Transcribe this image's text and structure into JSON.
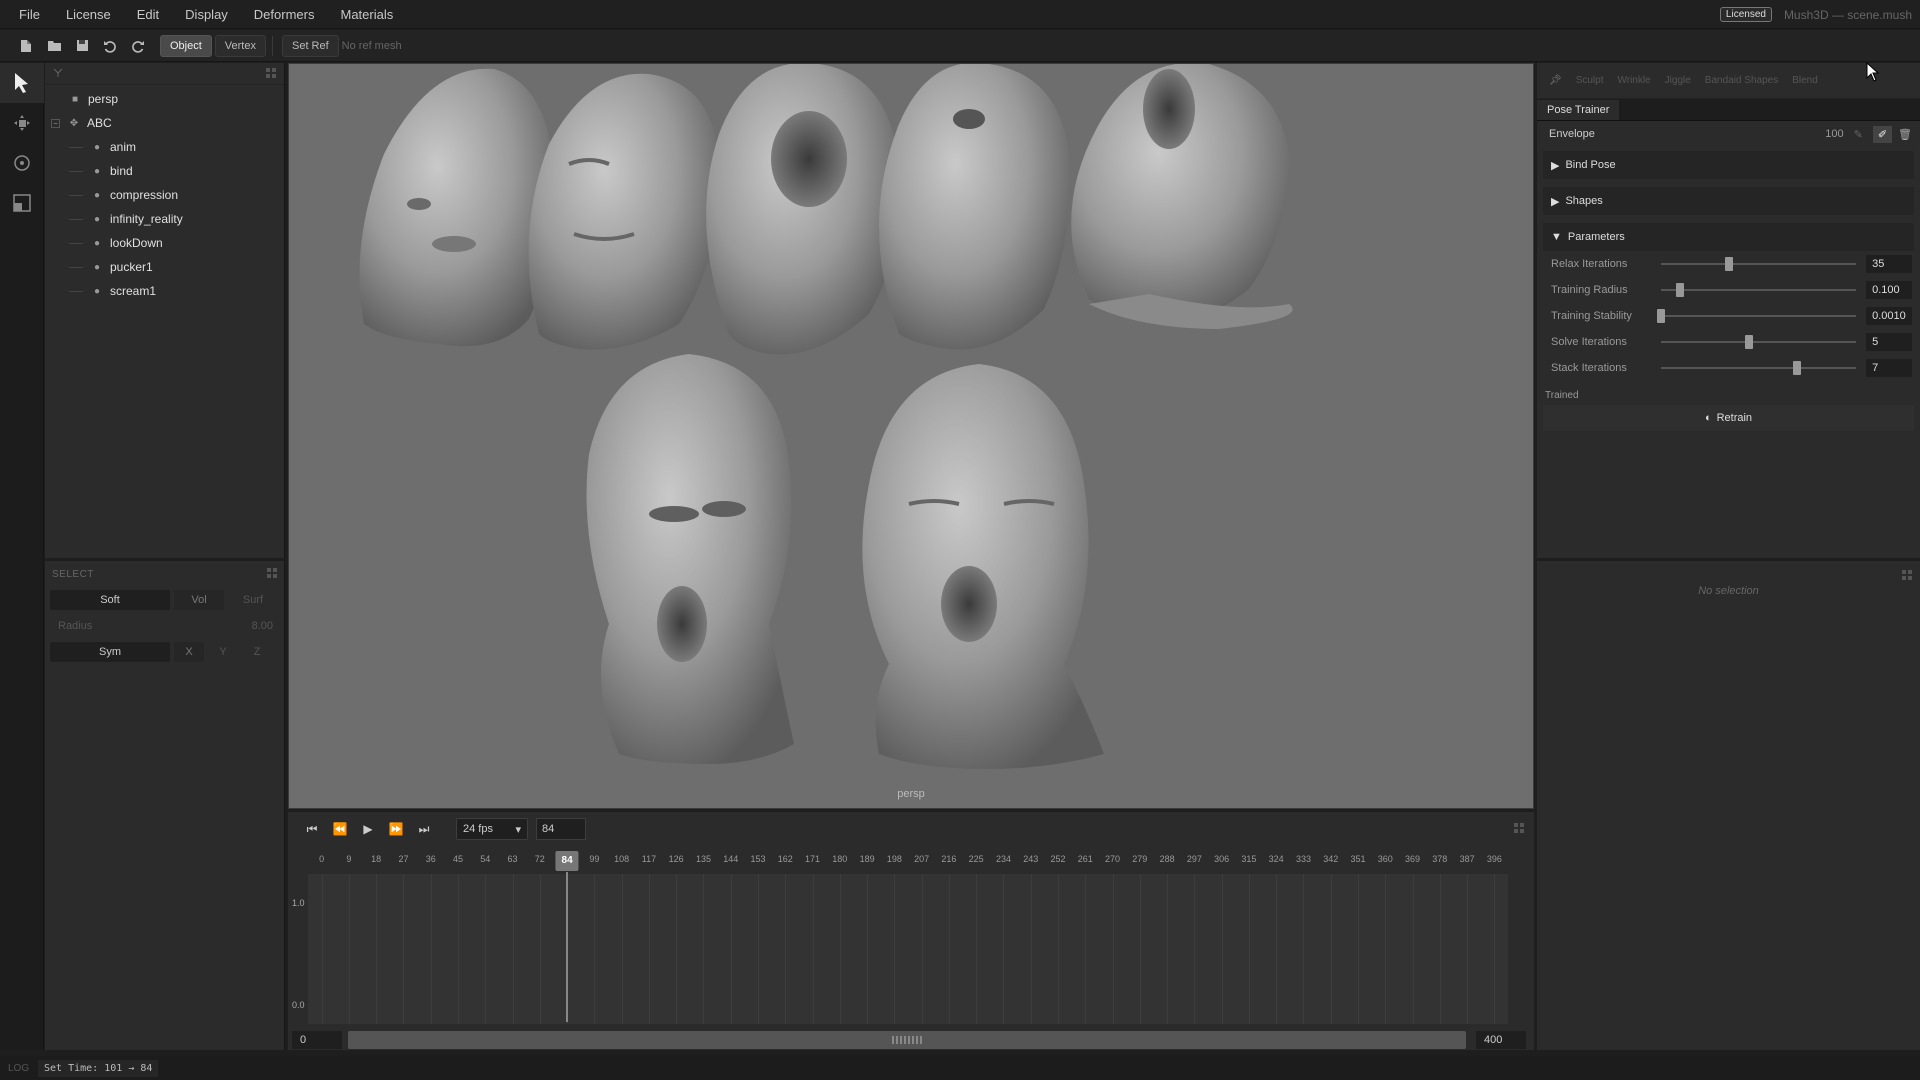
{
  "menu": {
    "items": [
      "File",
      "License",
      "Edit",
      "Display",
      "Deformers",
      "Materials"
    ],
    "licensed_badge": "Licensed",
    "window_title": "Mush3D — scene.mush"
  },
  "toolbar": {
    "object_label": "Object",
    "vertex_label": "Vertex",
    "set_ref_label": "Set Ref",
    "ref_status": "No ref mesh"
  },
  "outliner": {
    "camera": "persp",
    "root": "ABC",
    "children": [
      "anim",
      "bind",
      "compression",
      "infinity_reality",
      "lookDown",
      "pucker1",
      "scream1"
    ]
  },
  "select_panel": {
    "title": "SELECT",
    "soft_label": "Soft",
    "vol_label": "Vol",
    "surf_label": "Surf",
    "radius_label": "Radius",
    "radius_value": "8.00",
    "sym_label": "Sym",
    "axes": [
      "X",
      "Y",
      "Z"
    ]
  },
  "viewport": {
    "camera_label": "persp"
  },
  "timeline": {
    "fps_value": "24 fps",
    "current_frame": "84",
    "ruler_ticks": [
      "0",
      "9",
      "18",
      "27",
      "36",
      "45",
      "54",
      "63",
      "72",
      "84",
      "99",
      "108",
      "117",
      "126",
      "135",
      "144",
      "153",
      "162",
      "171",
      "180",
      "189",
      "198",
      "207",
      "216",
      "225",
      "234",
      "243",
      "252",
      "261",
      "270",
      "279",
      "288",
      "297",
      "306",
      "315",
      "324",
      "333",
      "342",
      "351",
      "360",
      "369",
      "378",
      "387",
      "396"
    ],
    "cursor_frame": 84,
    "y_max_label": "1.0",
    "y_min_label": "0.0",
    "range_start": "0",
    "range_end": "400"
  },
  "right_panel": {
    "tabs": [
      "Sculpt",
      "Wrinkle",
      "Jiggle",
      "Bandaid Shapes",
      "Blend"
    ],
    "title": "Pose Trainer",
    "envelope_label": "Envelope",
    "envelope_value": "100",
    "bind_pose_label": "Bind Pose",
    "shapes_label": "Shapes",
    "parameters_label": "Parameters",
    "params": [
      {
        "label": "Relax Iterations",
        "value": "35",
        "level": 0.35
      },
      {
        "label": "Training Radius",
        "value": "0.100",
        "level": 0.1
      },
      {
        "label": "Training Stability",
        "value": "0.0010",
        "level": 0.0
      },
      {
        "label": "Solve Iterations",
        "value": "5",
        "level": 0.45
      },
      {
        "label": "Stack Iterations",
        "value": "7",
        "level": 0.7
      }
    ],
    "trained_label": "Trained",
    "retrain_label": "Retrain",
    "no_selection": "No selection"
  },
  "status": {
    "log_label": "LOG",
    "log_text": "Set Time: 101 → 84"
  }
}
